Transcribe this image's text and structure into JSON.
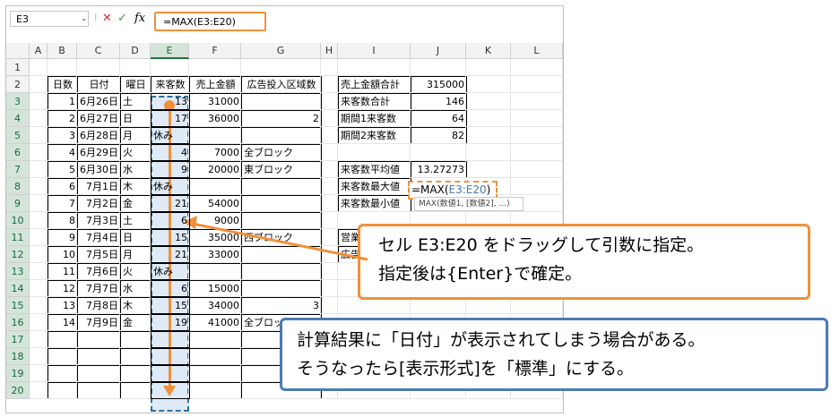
{
  "formula_bar": {
    "name_box": "E3",
    "formula": "=MAX(E3:E20)",
    "fx": "fx"
  },
  "columns": [
    "A",
    "B",
    "C",
    "D",
    "E",
    "F",
    "G",
    "H",
    "I",
    "J",
    "K",
    "L"
  ],
  "rows": [
    "1",
    "2",
    "3",
    "4",
    "5",
    "6",
    "7",
    "8",
    "9",
    "10",
    "11",
    "12",
    "13",
    "14",
    "15",
    "16",
    "17",
    "18",
    "19",
    "20"
  ],
  "table_header": [
    "日数",
    "日付",
    "曜日",
    "来客数",
    "売上金額",
    "広告投入区域数"
  ],
  "table_rows": [
    [
      "1",
      "6月26日",
      "土",
      "13",
      "31000",
      ""
    ],
    [
      "2",
      "6月27日",
      "日",
      "17",
      "36000",
      "2"
    ],
    [
      "3",
      "6月28日",
      "月",
      "休み",
      "",
      ""
    ],
    [
      "4",
      "6月29日",
      "火",
      "4",
      "7000",
      "全ブロック"
    ],
    [
      "5",
      "6月30日",
      "水",
      "9",
      "20000",
      "東ブロック"
    ],
    [
      "6",
      "7月1日",
      "木",
      "休み",
      "",
      ""
    ],
    [
      "7",
      "7月2日",
      "金",
      "21",
      "54000",
      ""
    ],
    [
      "8",
      "7月3日",
      "土",
      "6",
      "9000",
      ""
    ],
    [
      "9",
      "7月4日",
      "日",
      "15",
      "35000",
      "西ブロック"
    ],
    [
      "10",
      "7月5日",
      "月",
      "21",
      "33000",
      ""
    ],
    [
      "11",
      "7月6日",
      "火",
      "休み",
      "",
      ""
    ],
    [
      "12",
      "7月7日",
      "水",
      "6",
      "15000",
      ""
    ],
    [
      "13",
      "7月8日",
      "木",
      "15",
      "34000",
      "3"
    ],
    [
      "14",
      "7月9日",
      "金",
      "19",
      "41000",
      "全ブロック"
    ]
  ],
  "summary1": [
    [
      "売上金額合計",
      "315000"
    ],
    [
      "来客数合計",
      "146"
    ],
    [
      "期間1来客数",
      "64"
    ],
    [
      "期間2来客数",
      "82"
    ]
  ],
  "summary2": [
    [
      "来客数平均値",
      "13.27273"
    ],
    [
      "来客数最大値",
      "=MAX(E3:E20)"
    ],
    [
      "来客数最小値",
      ""
    ]
  ],
  "partial_labels": [
    "営業",
    "広告"
  ],
  "tooltip": "MAX(数値1, [数値2], ...)",
  "callout1": [
    "セル E3:E20 をドラッグして引数に指定。",
    "指定後は{Enter}で確定。"
  ],
  "callout2": [
    "計算結果に「日付」が表示されてしまう場合がある。",
    "そうなったら[表示形式]を「標準」にする。"
  ],
  "colors": {
    "accent_orange": "#f0903a",
    "accent_blue": "#4a7bb6",
    "excel_green": "#217346"
  }
}
